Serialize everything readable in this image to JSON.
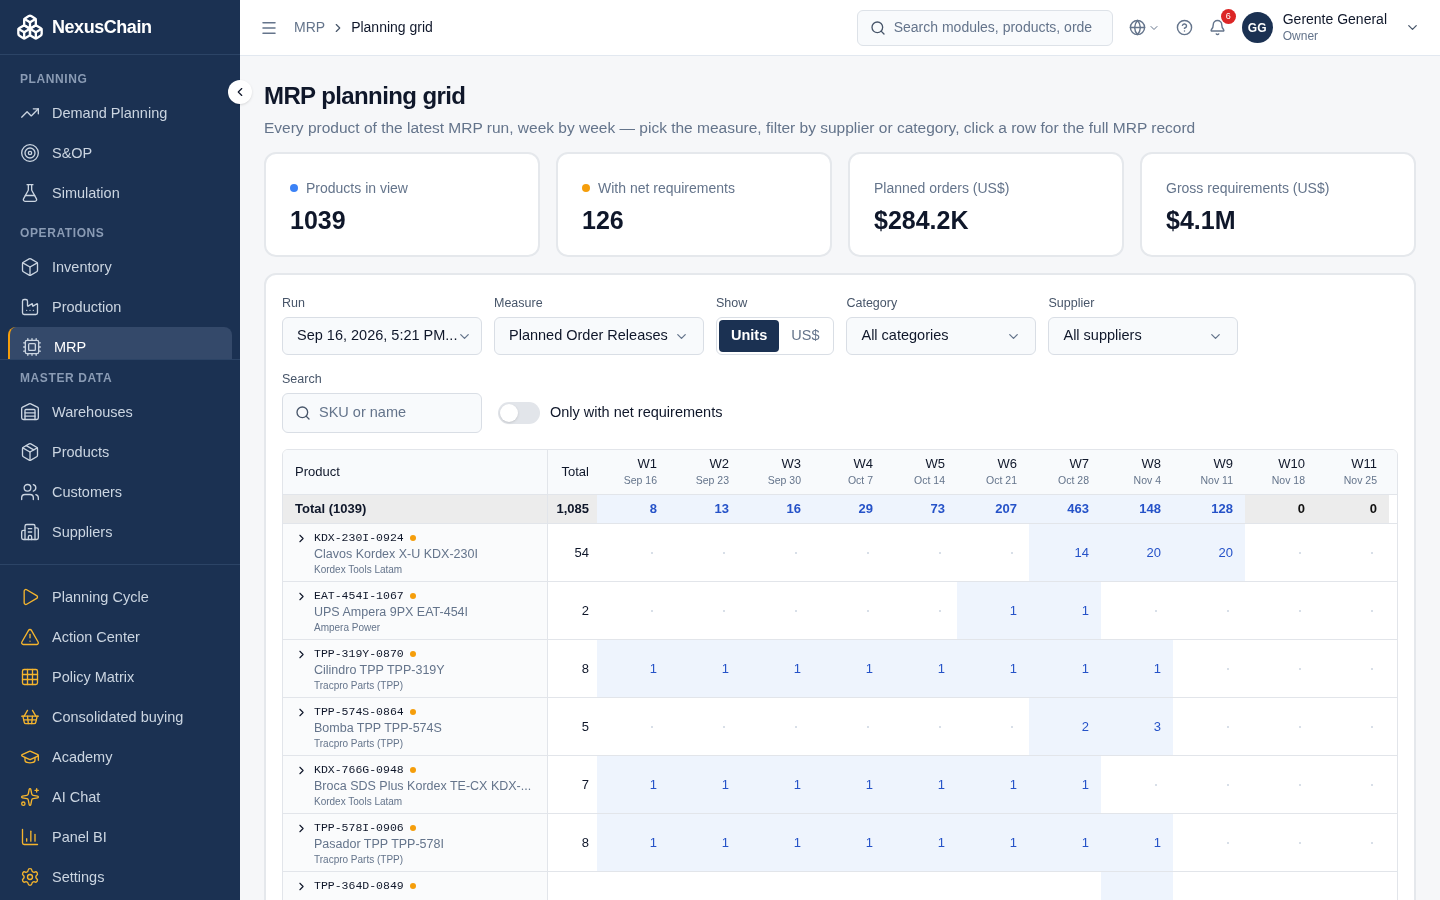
{
  "brand": "NexusChain",
  "sidebar": {
    "sections": [
      {
        "title": "PLANNING",
        "items": [
          {
            "label": "Demand Planning",
            "selected": false
          },
          {
            "label": "S&OP",
            "selected": false
          },
          {
            "label": "Simulation",
            "selected": false
          }
        ]
      },
      {
        "title": "OPERATIONS",
        "items": [
          {
            "label": "Inventory",
            "selected": false
          },
          {
            "label": "Production",
            "selected": false
          },
          {
            "label": "MRP",
            "selected": true
          }
        ]
      }
    ],
    "master": {
      "title": "MASTER DATA",
      "items": [
        {
          "label": "Warehouses",
          "selected": false
        },
        {
          "label": "Products",
          "selected": false
        },
        {
          "label": "Customers",
          "selected": false
        },
        {
          "label": "Suppliers",
          "selected": false
        }
      ]
    },
    "tools": [
      {
        "label": "Planning Cycle",
        "selected": false
      },
      {
        "label": "Action Center",
        "selected": false
      },
      {
        "label": "Policy Matrix",
        "selected": false
      },
      {
        "label": "Consolidated buying",
        "selected": false
      },
      {
        "label": "Academy",
        "selected": false
      },
      {
        "label": "AI Chat",
        "selected": false
      },
      {
        "label": "Panel BI",
        "selected": false
      },
      {
        "label": "Settings",
        "selected": false
      }
    ]
  },
  "breadcrumb": [
    "MRP",
    "Planning grid"
  ],
  "search": {
    "placeholder": "Search modules, products, orde"
  },
  "notifications": "6",
  "user": {
    "initials": "GG",
    "name": "Gerente General",
    "role": "Owner"
  },
  "title": "MRP planning grid",
  "subtitle": "Every product of the latest MRP run, week by week — pick the measure, filter by supplier or category, click a row for the full MRP record",
  "kpis": [
    {
      "label": "Products in view",
      "value": "1039",
      "color": "#3b82f6"
    },
    {
      "label": "With net requirements",
      "value": "126",
      "color": "#f59e0b"
    },
    {
      "label": "Planned orders (US$)",
      "value": "$284.2K"
    },
    {
      "label": "Gross requirements (US$)",
      "value": "$4.1M"
    }
  ],
  "filters": {
    "run": {
      "label": "Run",
      "value": "Sep 16, 2026, 5:21 PM..."
    },
    "measure": {
      "label": "Measure",
      "value": "Planned Order Releases"
    },
    "show": {
      "label": "Show",
      "options": [
        {
          "label": "Units",
          "selected": true
        },
        {
          "label": "US$",
          "selected": false
        }
      ]
    },
    "category": {
      "label": "Category",
      "value": "All categories"
    },
    "supplier": {
      "label": "Supplier",
      "value": "All suppliers"
    },
    "search": {
      "label": "Search",
      "placeholder": "SKU or name"
    },
    "net_only": {
      "label": "Only with net requirements",
      "on": false
    }
  },
  "table": {
    "columns": {
      "product": "Product",
      "total": "Total"
    },
    "weeks": [
      {
        "week": "W1",
        "date": "Sep 16"
      },
      {
        "week": "W2",
        "date": "Sep 23"
      },
      {
        "week": "W3",
        "date": "Sep 30"
      },
      {
        "week": "W4",
        "date": "Oct 7"
      },
      {
        "week": "W5",
        "date": "Oct 14"
      },
      {
        "week": "W6",
        "date": "Oct 21"
      },
      {
        "week": "W7",
        "date": "Oct 28"
      },
      {
        "week": "W8",
        "date": "Nov 4"
      },
      {
        "week": "W9",
        "date": "Nov 11"
      },
      {
        "week": "W10",
        "date": "Nov 18"
      },
      {
        "week": "W11",
        "date": "Nov 25"
      }
    ],
    "total_row": {
      "label": "Total (1039)",
      "total": "1,085",
      "cells": [
        {
          "value": "8",
          "planned": true
        },
        {
          "value": "13",
          "planned": true
        },
        {
          "value": "16",
          "planned": true
        },
        {
          "value": "29",
          "planned": true
        },
        {
          "value": "73",
          "planned": true
        },
        {
          "value": "207",
          "planned": true
        },
        {
          "value": "463",
          "planned": true
        },
        {
          "value": "148",
          "planned": true
        },
        {
          "value": "128",
          "planned": true
        },
        {
          "value": "0",
          "planned": false
        },
        {
          "value": "0",
          "planned": false
        }
      ]
    },
    "rows": [
      {
        "sku": "KDX-230I-0924",
        "name": "Clavos Kordex X-U KDX-230I",
        "supplier": "Kordex Tools Latam",
        "total": "54",
        "cells": [
          {
            "planned": false
          },
          {
            "planned": false
          },
          {
            "planned": false
          },
          {
            "planned": false
          },
          {
            "planned": false
          },
          {
            "planned": false
          },
          {
            "value": "14",
            "planned": true
          },
          {
            "value": "20",
            "planned": true
          },
          {
            "value": "20",
            "planned": true
          },
          {
            "planned": false
          },
          {
            "planned": false
          }
        ]
      },
      {
        "sku": "EAT-454I-1067",
        "name": "UPS Ampera 9PX EAT-454I",
        "supplier": "Ampera Power",
        "total": "2",
        "cells": [
          {
            "planned": false
          },
          {
            "planned": false
          },
          {
            "planned": false
          },
          {
            "planned": false
          },
          {
            "planned": false
          },
          {
            "value": "1",
            "planned": true
          },
          {
            "value": "1",
            "planned": true
          },
          {
            "planned": false
          },
          {
            "planned": false
          },
          {
            "planned": false
          },
          {
            "planned": false
          }
        ]
      },
      {
        "sku": "TPP-319Y-0870",
        "name": "Cilindro TPP TPP-319Y",
        "supplier": "Tracpro Parts (TPP)",
        "total": "8",
        "cells": [
          {
            "value": "1",
            "planned": true
          },
          {
            "value": "1",
            "planned": true
          },
          {
            "value": "1",
            "planned": true
          },
          {
            "value": "1",
            "planned": true
          },
          {
            "value": "1",
            "planned": true
          },
          {
            "value": "1",
            "planned": true
          },
          {
            "value": "1",
            "planned": true
          },
          {
            "value": "1",
            "planned": true
          },
          {
            "planned": false
          },
          {
            "planned": false
          },
          {
            "planned": false
          }
        ]
      },
      {
        "sku": "TPP-574S-0864",
        "name": "Bomba TPP TPP-574S",
        "supplier": "Tracpro Parts (TPP)",
        "total": "5",
        "cells": [
          {
            "planned": false
          },
          {
            "planned": false
          },
          {
            "planned": false
          },
          {
            "planned": false
          },
          {
            "planned": false
          },
          {
            "planned": false
          },
          {
            "value": "2",
            "planned": true
          },
          {
            "value": "3",
            "planned": true
          },
          {
            "planned": false
          },
          {
            "planned": false
          },
          {
            "planned": false
          }
        ]
      },
      {
        "sku": "KDX-766G-0948",
        "name": "Broca SDS Plus Kordex TE-CX KDX-...",
        "supplier": "Kordex Tools Latam",
        "total": "7",
        "cells": [
          {
            "value": "1",
            "planned": true
          },
          {
            "value": "1",
            "planned": true
          },
          {
            "value": "1",
            "planned": true
          },
          {
            "value": "1",
            "planned": true
          },
          {
            "value": "1",
            "planned": true
          },
          {
            "value": "1",
            "planned": true
          },
          {
            "value": "1",
            "planned": true
          },
          {
            "planned": false
          },
          {
            "planned": false
          },
          {
            "planned": false
          },
          {
            "planned": false
          }
        ]
      },
      {
        "sku": "TPP-578I-0906",
        "name": "Pasador TPP TPP-578I",
        "supplier": "Tracpro Parts (TPP)",
        "total": "8",
        "cells": [
          {
            "value": "1",
            "planned": true
          },
          {
            "value": "1",
            "planned": true
          },
          {
            "value": "1",
            "planned": true
          },
          {
            "value": "1",
            "planned": true
          },
          {
            "value": "1",
            "planned": true
          },
          {
            "value": "1",
            "planned": true
          },
          {
            "value": "1",
            "planned": true
          },
          {
            "value": "1",
            "planned": true
          },
          {
            "planned": false
          },
          {
            "planned": false
          },
          {
            "planned": false
          }
        ]
      },
      {
        "sku": "TPP-364D-0849",
        "cells": [
          {
            "planned": false
          },
          {
            "planned": false
          },
          {
            "planned": false
          },
          {
            "planned": false
          },
          {
            "planned": false
          },
          {
            "planned": false
          },
          {
            "planned": false
          },
          {
            "planned": true
          },
          {
            "planned": false
          },
          {
            "planned": false
          },
          {
            "planned": false
          }
        ]
      }
    ]
  }
}
